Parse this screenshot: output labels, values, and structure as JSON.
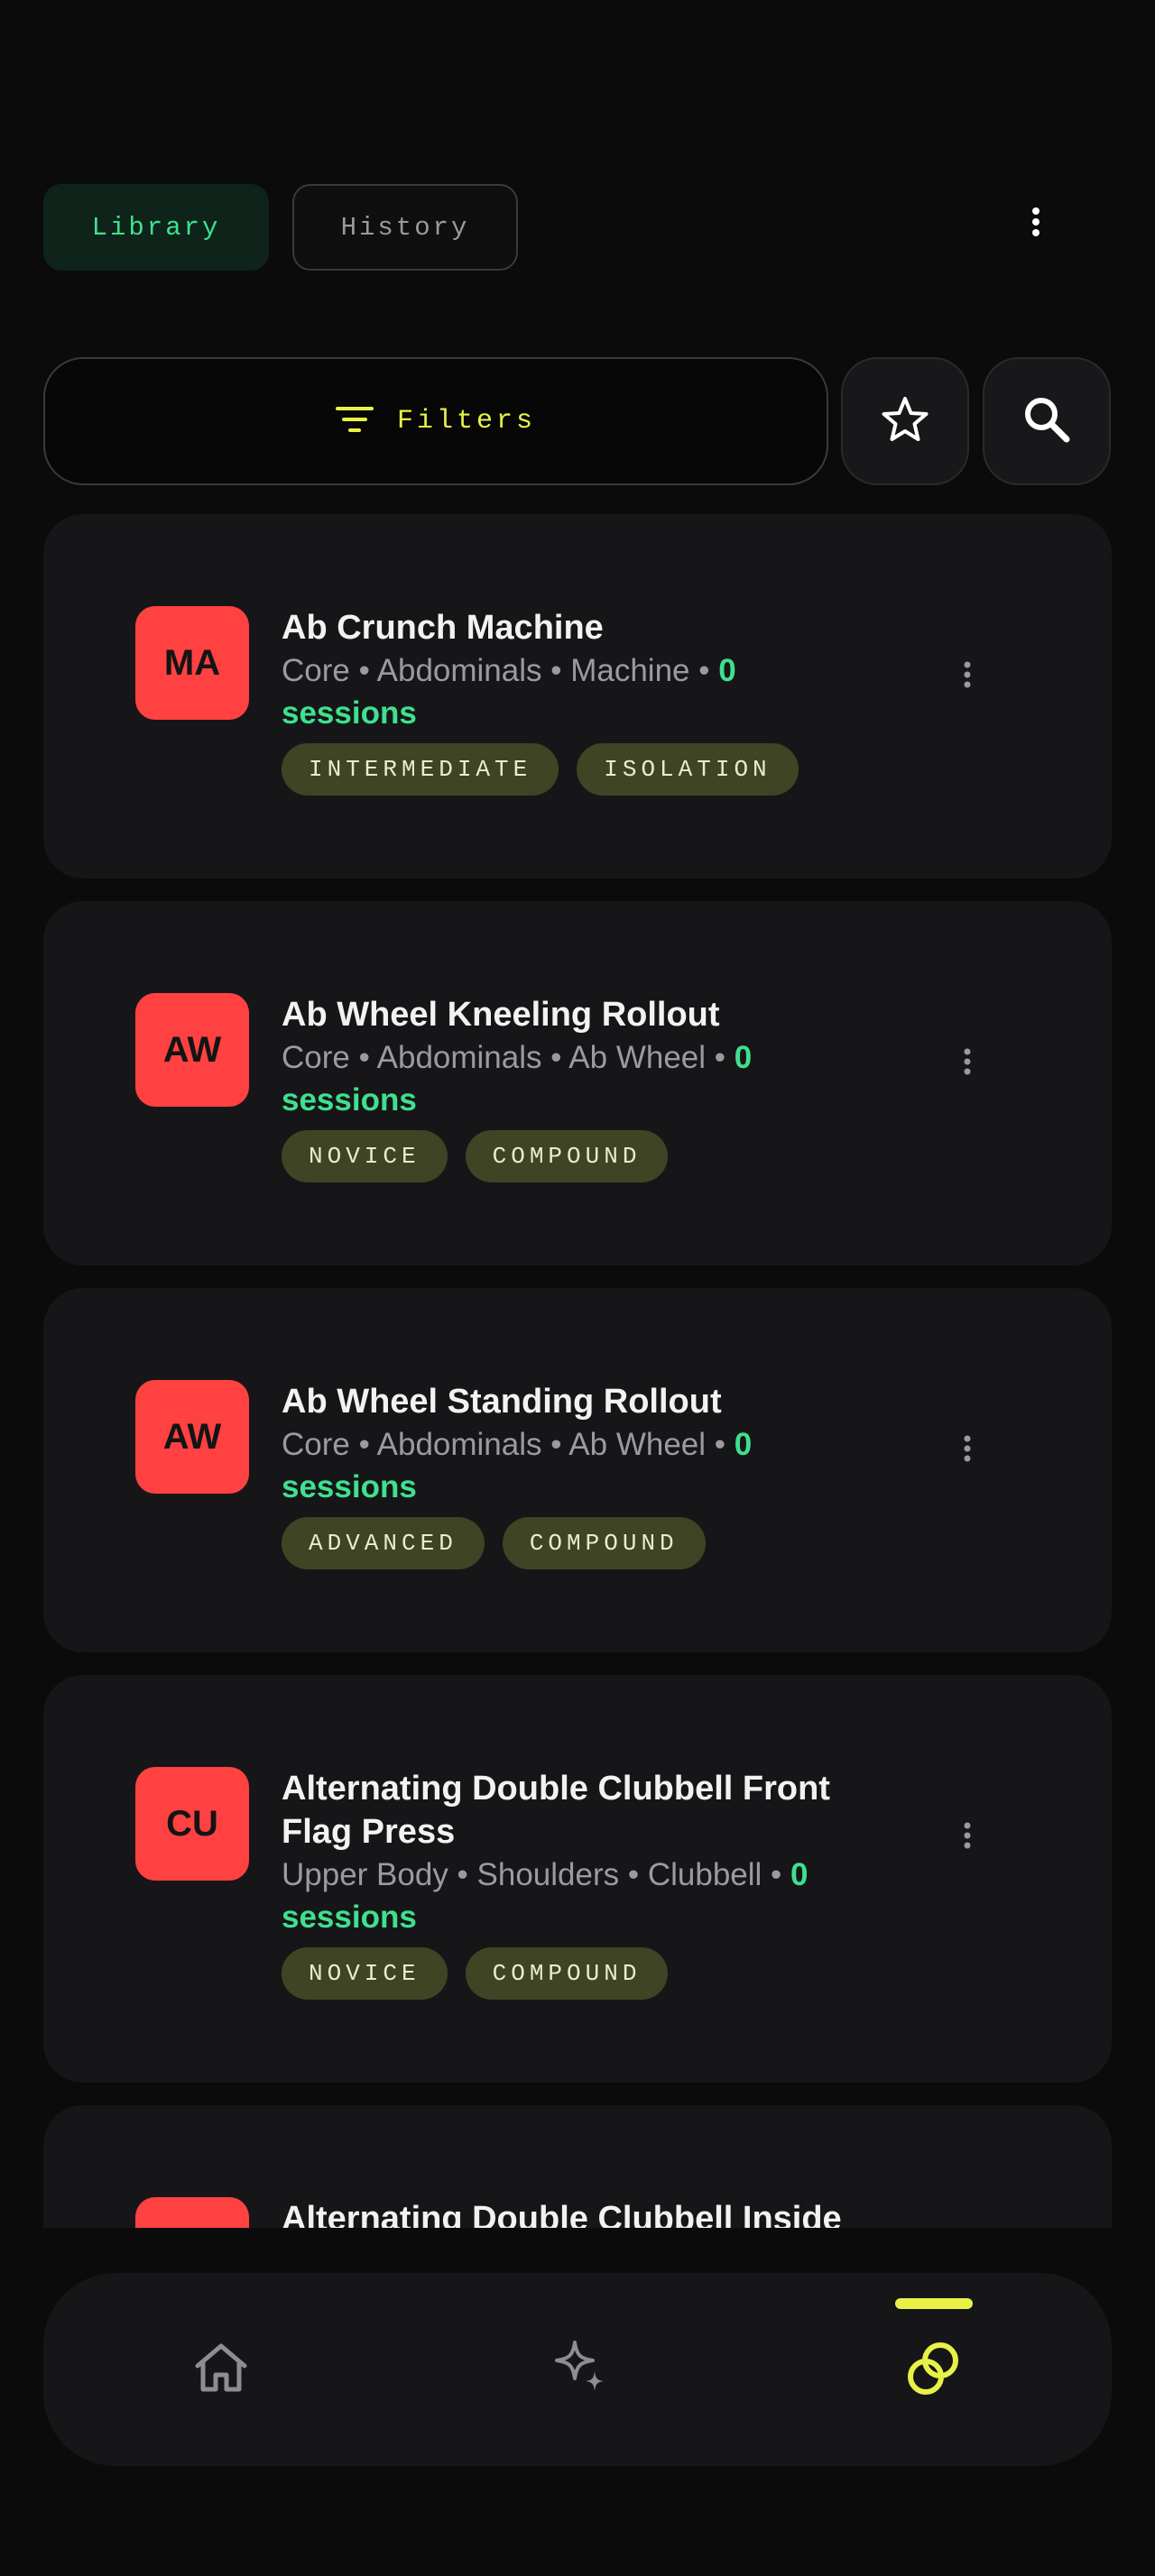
{
  "tabs": {
    "library": "Library",
    "history": "History"
  },
  "toolbar": {
    "filters_label": "Filters"
  },
  "icons": {
    "menu": "more-vert-icon",
    "filter": "filter-lines-icon",
    "favorite": "star-outline-icon",
    "search": "search-icon",
    "home": "home-icon",
    "ai": "sparkles-icon",
    "library": "linked-rings-icon"
  },
  "colors": {
    "background": "#0b0b0c",
    "card": "#161618",
    "accent_green": "#3fe08e",
    "accent_yellow": "#e8f246",
    "avatar_red": "#ff4141",
    "chip_bg": "#3f4424"
  },
  "exercises": [
    {
      "initials": "MA",
      "name": "Ab Crunch Machine",
      "meta": "Core • Abdominals • Machine • ",
      "sessions": "0 sessions",
      "tags": [
        "INTERMEDIATE",
        "ISOLATION"
      ]
    },
    {
      "initials": "AW",
      "name": "Ab Wheel Kneeling Rollout",
      "meta": "Core • Abdominals • Ab Wheel • ",
      "sessions": "0 sessions",
      "tags": [
        "NOVICE",
        "COMPOUND"
      ]
    },
    {
      "initials": "AW",
      "name": "Ab Wheel Standing Rollout",
      "meta": "Core • Abdominals • Ab Wheel • ",
      "sessions": "0 sessions",
      "tags": [
        "ADVANCED",
        "COMPOUND"
      ]
    },
    {
      "initials": "CU",
      "name": "Alternating Double Clubbell Front Flag Press",
      "meta": "Upper Body • Shoulders • Clubbell • ",
      "sessions": "0 sessions",
      "tags": [
        "NOVICE",
        "COMPOUND"
      ]
    },
    {
      "initials": "",
      "name": "Alternating Double Clubbell Inside",
      "meta": "",
      "sessions": "",
      "tags": []
    }
  ]
}
